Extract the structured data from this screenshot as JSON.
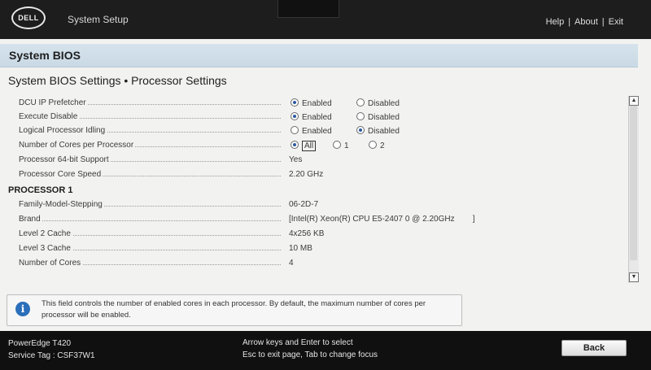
{
  "header": {
    "logo_text": "DELL",
    "app_title": "System Setup",
    "links": [
      "Help",
      "About",
      "Exit"
    ],
    "separator": "|"
  },
  "page": {
    "band_title": "System BIOS",
    "breadcrumb": "System BIOS Settings • Processor Settings"
  },
  "settings": [
    {
      "label": "DCU IP Prefetcher",
      "type": "radio",
      "options": [
        "Enabled",
        "Disabled"
      ],
      "selected": 0
    },
    {
      "label": "Execute Disable",
      "type": "radio",
      "options": [
        "Enabled",
        "Disabled"
      ],
      "selected": 0
    },
    {
      "label": "Logical Processor Idling",
      "type": "radio",
      "options": [
        "Enabled",
        "Disabled"
      ],
      "selected": 1
    },
    {
      "label": "Number of Cores per Processor",
      "type": "radio",
      "options": [
        "All",
        "1",
        "2"
      ],
      "selected": 0
    },
    {
      "label": "Processor 64-bit Support",
      "type": "text",
      "value": "Yes"
    },
    {
      "label": "Processor Core Speed",
      "type": "text",
      "value": "2.20 GHz"
    }
  ],
  "processor_section": {
    "title": "PROCESSOR 1",
    "rows": [
      {
        "label": "Family-Model-Stepping",
        "value": "06-2D-7"
      },
      {
        "label": "Brand",
        "value": "[Intel(R) Xeon(R) CPU E5-2407 0 @ 2.20GHz        ]"
      },
      {
        "label": "Level 2 Cache",
        "value": "4x256 KB"
      },
      {
        "label": "Level 3 Cache",
        "value": "10 MB"
      },
      {
        "label": "Number of Cores",
        "value": "4"
      }
    ]
  },
  "help": {
    "icon": "info-icon",
    "text": "This field controls the number of enabled cores in each processor. By default, the maximum number of cores per processor will be enabled."
  },
  "footer": {
    "model": "PowerEdge T420",
    "service_tag": "Service Tag : CSF37W1",
    "hint_line1": "Arrow keys and Enter to select",
    "hint_line2": "Esc to exit page, Tab to change focus",
    "back_label": "Back"
  },
  "colors": {
    "band": "#cbdae6",
    "radio_selected": "#2c5aa0",
    "info_icon": "#2b6fba"
  }
}
